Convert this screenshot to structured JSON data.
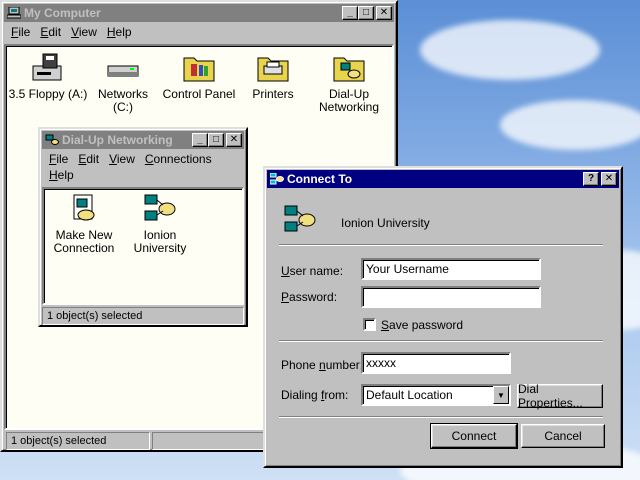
{
  "my_computer": {
    "title": "My Computer",
    "menu": [
      "File",
      "Edit",
      "View",
      "Help"
    ],
    "icons": [
      {
        "label": "3.5 Floppy (A:)",
        "icon": "floppy-drive-icon"
      },
      {
        "label": "Networks (C:)",
        "icon": "hard-drive-icon"
      },
      {
        "label": "Control Panel",
        "icon": "control-panel-folder-icon"
      },
      {
        "label": "Printers",
        "icon": "printers-folder-icon"
      },
      {
        "label": "Dial-Up",
        "label2": "Networking",
        "icon": "dialup-folder-icon"
      }
    ],
    "status": "1 object(s) selected"
  },
  "dialup": {
    "title": "Dial-Up Networking",
    "menu": [
      "File",
      "Edit",
      "View",
      "Connections",
      "Help"
    ],
    "icons": [
      {
        "label": "Make New",
        "label2": "Connection",
        "icon": "make-new-connection-icon"
      },
      {
        "label": "Ionion",
        "label2": "University",
        "icon": "connection-icon"
      }
    ],
    "status": "1 object(s) selected"
  },
  "connect": {
    "title": "Connect To",
    "help_btn": "?",
    "close_btn": "✕",
    "connection_name": "Ionion University",
    "user_label": "User name:",
    "user_value": "Your Username",
    "password_label": "Password:",
    "password_value": "",
    "save_password_label": "Save password",
    "phone_label": "Phone number:",
    "phone_value": "xxxxx",
    "dialing_label": "Dialing from:",
    "dialing_value": "Default Location",
    "dial_properties": "Dial Properties...",
    "connect_btn": "Connect",
    "cancel_btn": "Cancel"
  }
}
